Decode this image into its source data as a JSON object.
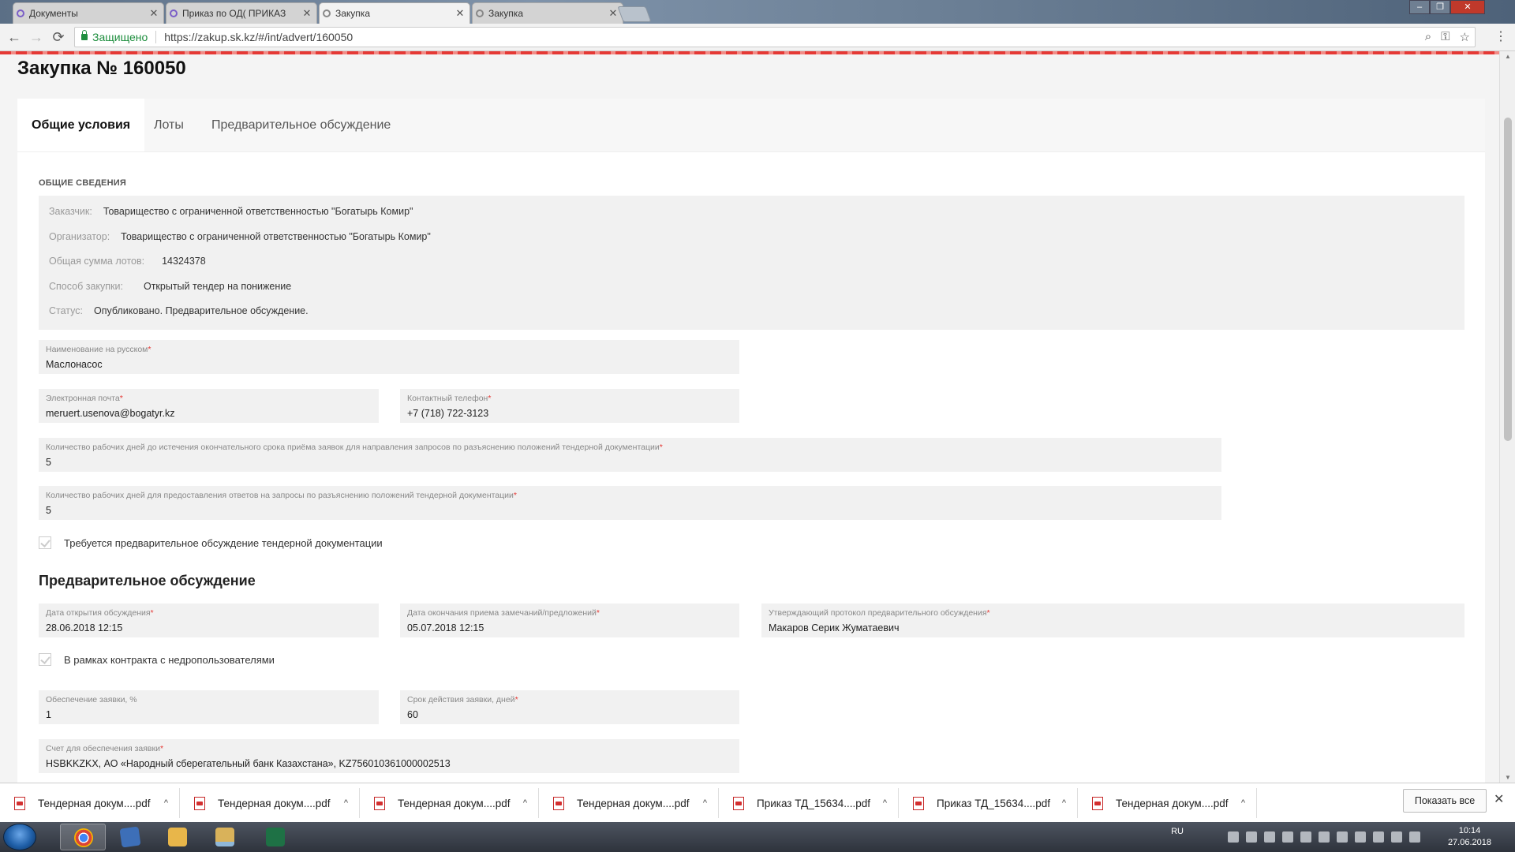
{
  "browser": {
    "tabs": [
      {
        "title": "Документы",
        "favicon": "circle-icon"
      },
      {
        "title": "Приказ по ОД( ПРИКАЗ",
        "favicon": "circle-icon"
      },
      {
        "title": "Закупка",
        "favicon": "globe-icon",
        "active": true
      },
      {
        "title": "Закупка",
        "favicon": "globe-icon"
      }
    ],
    "tab_close": "✕",
    "secure_label": "Защищено",
    "url": "https://zakup.sk.kz/#/int/advert/160050",
    "icons": [
      "back-icon",
      "forward-icon",
      "reload-icon",
      "zoom-icon",
      "key-icon",
      "star-icon",
      "menu-icon"
    ]
  },
  "page": {
    "title": "Закупка № 160050",
    "tabs": [
      "Общие условия",
      "Лоты",
      "Предварительное обсуждение"
    ],
    "active_tab": 0,
    "general_section": {
      "heading": "ОБЩИЕ СВЕДЕНИЯ",
      "rows": [
        {
          "label": "Заказчик:",
          "value": "Товарищество с ограниченной ответственностью \"Богатырь Комир\""
        },
        {
          "label": "Организатор:",
          "value": "Товарищество с ограниченной ответственностью \"Богатырь Комир\""
        },
        {
          "label": "Общая сумма лотов:",
          "value": "14324378"
        },
        {
          "label": "Способ закупки:",
          "value": "Открытый тендер на понижение"
        },
        {
          "label": "Статус:",
          "value": "Опубликовано. Предварительное обсуждение."
        }
      ]
    },
    "fields": {
      "name_ru": {
        "label": "Наименование на русском",
        "value": "Маслонасос"
      },
      "email": {
        "label": "Электронная почта",
        "value": "meruert.usenova@bogatyr.kz"
      },
      "phone": {
        "label": "Контактный телефон",
        "value": "+7 (718) 722-3123"
      },
      "days_requests": {
        "label": "Количество рабочих дней до истечения окончательного срока приёма заявок для направления запросов по разъяснению положений тендерной документации",
        "value": "5"
      },
      "days_answers": {
        "label": "Количество рабочих дней для предоставления ответов на запросы по разъяснению положений тендерной документации",
        "value": "5"
      }
    },
    "checkbox_prelim": {
      "label": "Требуется предварительное обсуждение тендерной документации",
      "checked": true
    },
    "prelim_section": {
      "title": "Предварительное обсуждение",
      "open_date": {
        "label": "Дата открытия обсуждения",
        "value": "28.06.2018 12:15"
      },
      "close_date": {
        "label": "Дата окончания приема замечаний/предложений",
        "value": "05.07.2018 12:15"
      },
      "approver": {
        "label": "Утверждающий протокол предварительного обсуждения",
        "value": "Макаров Серик Жуматаевич"
      }
    },
    "checkbox_subsoil": {
      "label": "В рамках контракта с недропользователями",
      "checked": true
    },
    "security": {
      "label": "Обеспечение заявки, %",
      "value": "1"
    },
    "validity": {
      "label": "Срок действия заявки, дней",
      "value": "60"
    },
    "account": {
      "label": "Счет для обеспечения заявки",
      "value": "HSBKKZKX, АО «Народный сберегательный банк Казахстана», KZ756010361000002513"
    },
    "required_mark": "*"
  },
  "downloads": {
    "items": [
      "Тендерная докум....pdf",
      "Тендерная докум....pdf",
      "Тендерная докум....pdf",
      "Тендерная докум....pdf",
      "Приказ ТД_15634....pdf",
      "Приказ ТД_15634....pdf",
      "Тендерная докум....pdf"
    ],
    "chevron": "^",
    "show_all": "Показать все",
    "close": "✕"
  },
  "taskbar": {
    "apps": [
      "chrome-icon",
      "notes-icon",
      "folder-icon",
      "explorer-icon",
      "excel-icon"
    ],
    "lang": "RU",
    "time": "10:14",
    "date": "27.06.2018"
  },
  "colors": {
    "required": "#e53935",
    "secure": "#1e8e3e",
    "accent_stripe": "#e53935"
  }
}
